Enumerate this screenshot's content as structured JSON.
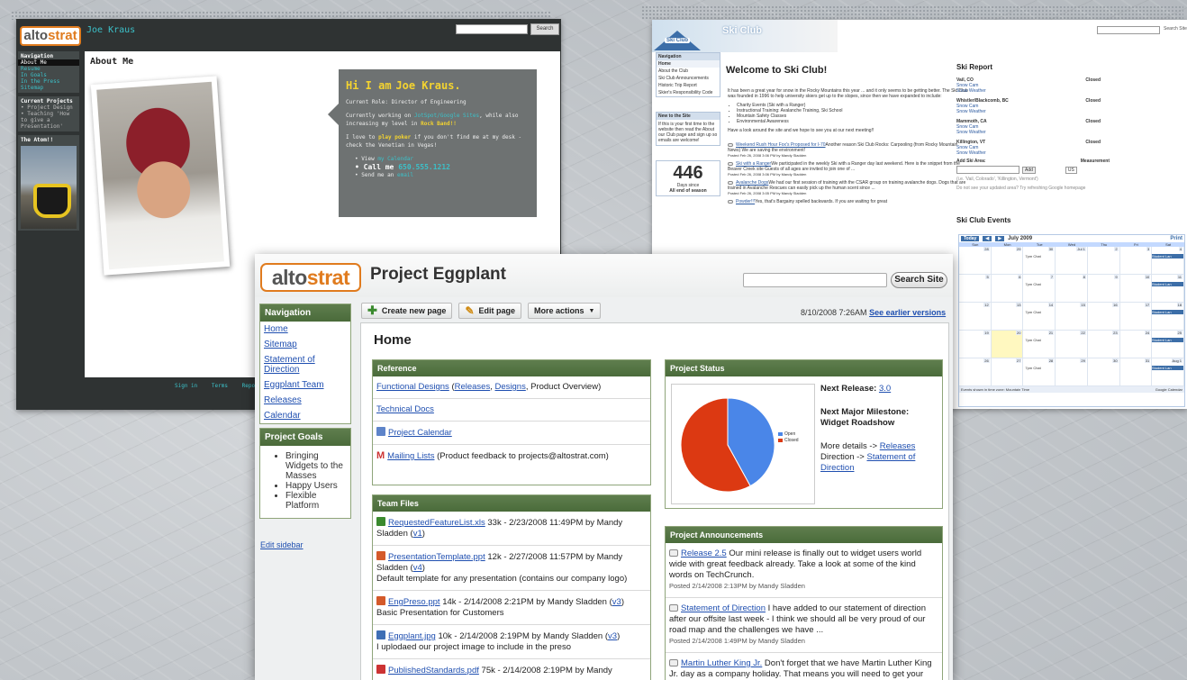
{
  "joe": {
    "logo_prefix": "alto",
    "logo_suffix": "strat",
    "title": "Joe Kraus",
    "search_button": "Search Site",
    "nav_header": "Navigation",
    "nav_items": [
      "About Me",
      "Resume",
      "In Goals",
      "In the Press",
      "Sitemap"
    ],
    "projects_header": "Current Projects",
    "projects_text": "• Project Design • Teaching 'How to give a Presentation'",
    "atom_header": "The Atom!!",
    "page_heading": "About Me",
    "greeting": "Hi I am",
    "greeting_name": "Joe Kraus.",
    "role": "Current Role: Director of Engineering",
    "working": "Currently working on",
    "working_link": "JotSpot/Google Sites",
    "working_tail": ", while also increasing my level in",
    "rock_band": "Rock Band!!",
    "poker_pre": "I love to",
    "poker": "play poker",
    "poker_tail": "if you don't find me at my desk - check the Venetian in Vegas!",
    "bullet_view": "View",
    "bullet_view_link": "my Calendar",
    "bullet_call": "Call me",
    "phone": "650.555.1212",
    "bullet_send": "Send me an",
    "bullet_send_link": "email",
    "footer_links": [
      "Sign in",
      "Terms",
      "Report Abuse"
    ]
  },
  "ski": {
    "logo": "Ski Club",
    "title": "Ski Club",
    "search_button": "Search Site",
    "nav_header": "Navigation",
    "nav_items": [
      "Home",
      "About the Club",
      "Ski Club Announcements",
      "Historic Trip Report",
      "Skier's Responsibility Code"
    ],
    "new_header": "New to the Site",
    "new_text": "If this is your first time to the website then read the About our Club page and sign up so emails are welcome!",
    "count": "446",
    "count_sub1": "Days since",
    "count_sub2": "All end of season",
    "welcome": "Welcome to Ski Club!",
    "intro": "It has been a great year for snow in the Rocky Mountains this year ... and it only seems to be getting better. The Ski Club was founded in 1996 to help university skiers get up to the slopes, since then we have expanded to include:",
    "bullets": [
      "Charity Events (Ski with a Ranger)",
      "Instructional Training: Avalanche Training, Ski School",
      "Mountain Safety Classes",
      "Environmental Awareness"
    ],
    "outro": "Have a look around the site and we hope to see you at our next meeting!!",
    "posts": [
      {
        "link": "Weekend Rush Hour Fox's Proposed for I-70",
        "text": "Another reason Ski Club Rocks: Carpooling (from Rocky Mountain News) We are saving the environment!",
        "posted": "Posted Feb 26, 2008 3:06 PM by Mandy Sladden"
      },
      {
        "link": "Ski with a Ranger",
        "text": "We participated in the weekly Ski with a Ranger day last weekend. Here is the snippet from the Beaver Creek site Guests of all ages are invited to join one of ...",
        "posted": "Posted Feb 26, 2008 3:06 PM by Mandy Sladden"
      },
      {
        "link": "Avalanche Dogs",
        "text": "We had our first session of training with the CSAR group on training avalanche dogs. Dogs that are trained in Avalanche Rescues can easily pick up the human scent since ...",
        "posted": "Posted Feb 26, 2008 3:05 PM by Mandy Sladden"
      },
      {
        "link": "Powder!!!",
        "text": "Yes, that's Bargainy spelled backwards. If you are waiting for great",
        "posted": ""
      }
    ],
    "report_title": "Ski Report",
    "report": [
      {
        "name": "Vail, CO",
        "links": [
          "Snow Cam",
          "Snow Weather"
        ],
        "status": "Closed"
      },
      {
        "name": "Whistler/Blackcomb, BC",
        "links": [
          "Snow Cam",
          "Snow Weather"
        ],
        "status": "Closed"
      },
      {
        "name": "Mammoth, CA",
        "links": [
          "Snow Cam",
          "Snow Weather"
        ],
        "status": "Closed"
      },
      {
        "name": "Killington, VT",
        "links": [
          "Snow Cam",
          "Snow Weather"
        ],
        "status": "Closed"
      }
    ],
    "add_area": "Add Ski Area:",
    "measurement": "Measurement",
    "add_button": "Add",
    "unit": "US",
    "area_hint": "(i.e. 'Vail, Colorado', 'Killington, Vermont')",
    "update_hint": "Do not see your updated area? Try refreshing Google homepage",
    "events_title": "Ski Club Events",
    "cal_today": "Today",
    "cal_month": "July 2009",
    "cal_print": "Print",
    "dow": [
      "Sun",
      "Mon",
      "Tue",
      "Wed",
      "Thu",
      "Fri",
      "Sat"
    ],
    "cal_event": "7pm Chat",
    "cal_student": "Student Lan",
    "cal_footer": "Events shown in time zone: Mountain Time",
    "cal_google": "Google Calendar"
  },
  "egg": {
    "logo_prefix": "alto",
    "logo_suffix": "strat",
    "title": "Project Eggplant",
    "search_button": "Search Site",
    "nav_header": "Navigation",
    "nav_items": [
      "Home",
      "Sitemap",
      "Statement of Direction",
      "Eggplant Team",
      "Releases",
      "Calendar"
    ],
    "goals_header": "Project Goals",
    "goals": [
      "Bringing Widgets to the Masses",
      "Happy Users",
      "Flexible Platform"
    ],
    "edit_sidebar": "Edit sidebar",
    "toolbar": {
      "create": "Create new page",
      "edit": "Edit page",
      "more": "More actions"
    },
    "datetime": "8/10/2008 7:26AM",
    "earlier": "See earlier versions",
    "home": "Home",
    "reference": {
      "title": "Reference",
      "row1_link": "Functional Designs",
      "row1_open": "(",
      "row1_releases": "Releases",
      "row1_sep": ",",
      "row1_designs": "Designs",
      "row1_tail": ", Product Overview)",
      "row2_link": "Technical Docs",
      "row3_link": "Project Calendar",
      "row4_link": "Mailing Lists",
      "row4_tail": "(Product feedback to projects@altostrat.com)"
    },
    "files": {
      "title": "Team Files",
      "items": [
        {
          "icon": "xls",
          "name": "RequestedFeatureList.xls",
          "meta": " 33k - 2/23/2008 11:49PM by Mandy Sladden ",
          "ver": "v1",
          "desc": ""
        },
        {
          "icon": "ppt",
          "name": "PresentationTemplate.ppt",
          "meta": " 12k - 2/27/2008 11:57PM by Mandy Sladden ",
          "ver": "v4",
          "desc": "Default template for any presentation (contains our company logo)"
        },
        {
          "icon": "ppt",
          "name": "EngPreso.ppt",
          "meta": " 14k - 2/14/2008 2:21PM by Mandy Sladden ",
          "ver": "v3",
          "desc": "Basic Presentation for Customers"
        },
        {
          "icon": "jpg",
          "name": "Eggplant.jpg",
          "meta": " 10k - 2/14/2008 2:19PM by Mandy Sladden ",
          "ver": "v3",
          "desc": "I uplodaed our project image to include in the preso"
        },
        {
          "icon": "pdf",
          "name": "PublishedStandards.pdf",
          "meta": " 75k - 2/14/2008 2:19PM by Mandy",
          "ver": "",
          "desc": ""
        }
      ]
    },
    "status": {
      "title": "Project Status",
      "next_release_label": "Next Release:",
      "next_release": "3.0",
      "milestone_label": "Next Major Milestone:",
      "milestone": "Widget Roadshow",
      "details": "More details ->",
      "details_link": "Releases",
      "direction": "Direction ->",
      "direction_link": "Statement of Direction"
    },
    "announcements": {
      "title": "Project Announcements",
      "items": [
        {
          "link": "Release 2.5",
          "text": " Our mini release is finally out to widget users world wide with great feedback already. Take a look at some of the kind words on TechCrunch.",
          "posted": "Posted 2/14/2008 2:13PM by Mandy Sladden"
        },
        {
          "link": "Statement of Direction",
          "text": " I have added to our statement of direction after our offsite last week - I think we should all be very proud of our road map and the challenges we have ...",
          "posted": "Posted 2/14/2008 1:49PM by Mandy Sladden"
        },
        {
          "link": "Martin Luther King Jr.",
          "text": " Don't forget that we have Martin Luther King Jr. day as a company holiday. That means you will need to get your code in before the end of the ...",
          "posted": ""
        }
      ]
    }
  },
  "chart_data": {
    "type": "pie",
    "categories": [
      "Open",
      "Closed"
    ],
    "values": [
      42,
      58
    ],
    "colors": [
      "#4a86e8",
      "#dc3912"
    ]
  }
}
